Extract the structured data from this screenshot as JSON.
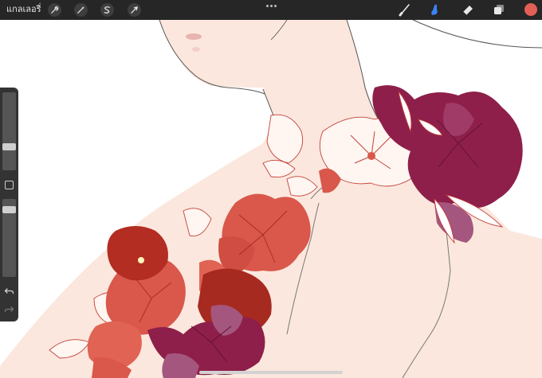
{
  "app": {
    "gallery_label": "แกลเลอรี่"
  },
  "toolbar": {
    "left_tools": [
      {
        "name": "actions",
        "icon": "wrench-icon"
      },
      {
        "name": "adjustments",
        "icon": "magic-wand-icon"
      },
      {
        "name": "selection",
        "icon": "selection-s-icon"
      },
      {
        "name": "transform",
        "icon": "arrow-cursor-icon"
      }
    ],
    "more_icon": "ellipsis-icon",
    "right_tools": [
      {
        "name": "brush",
        "icon": "brush-icon",
        "active": false
      },
      {
        "name": "smudge",
        "icon": "smudge-icon",
        "active": true
      },
      {
        "name": "eraser",
        "icon": "eraser-icon",
        "active": false
      },
      {
        "name": "layers",
        "icon": "layers-icon",
        "active": false
      }
    ],
    "current_color": "#e35f55",
    "active_tool_color": "#3b82f6"
  },
  "sidebar": {
    "brush_size_level": 0.28,
    "opacity_level": 0.9,
    "modify_button_icon": "square-icon",
    "undo_icon": "undo-icon",
    "redo_icon": "redo-icon"
  },
  "palette": {
    "skin": "#fbe7dd",
    "rose_red": "#d9574b",
    "deep_red": "#b32d22",
    "plum": "#8e1f4a",
    "mauve": "#a5567e",
    "line": "#c5403a"
  }
}
